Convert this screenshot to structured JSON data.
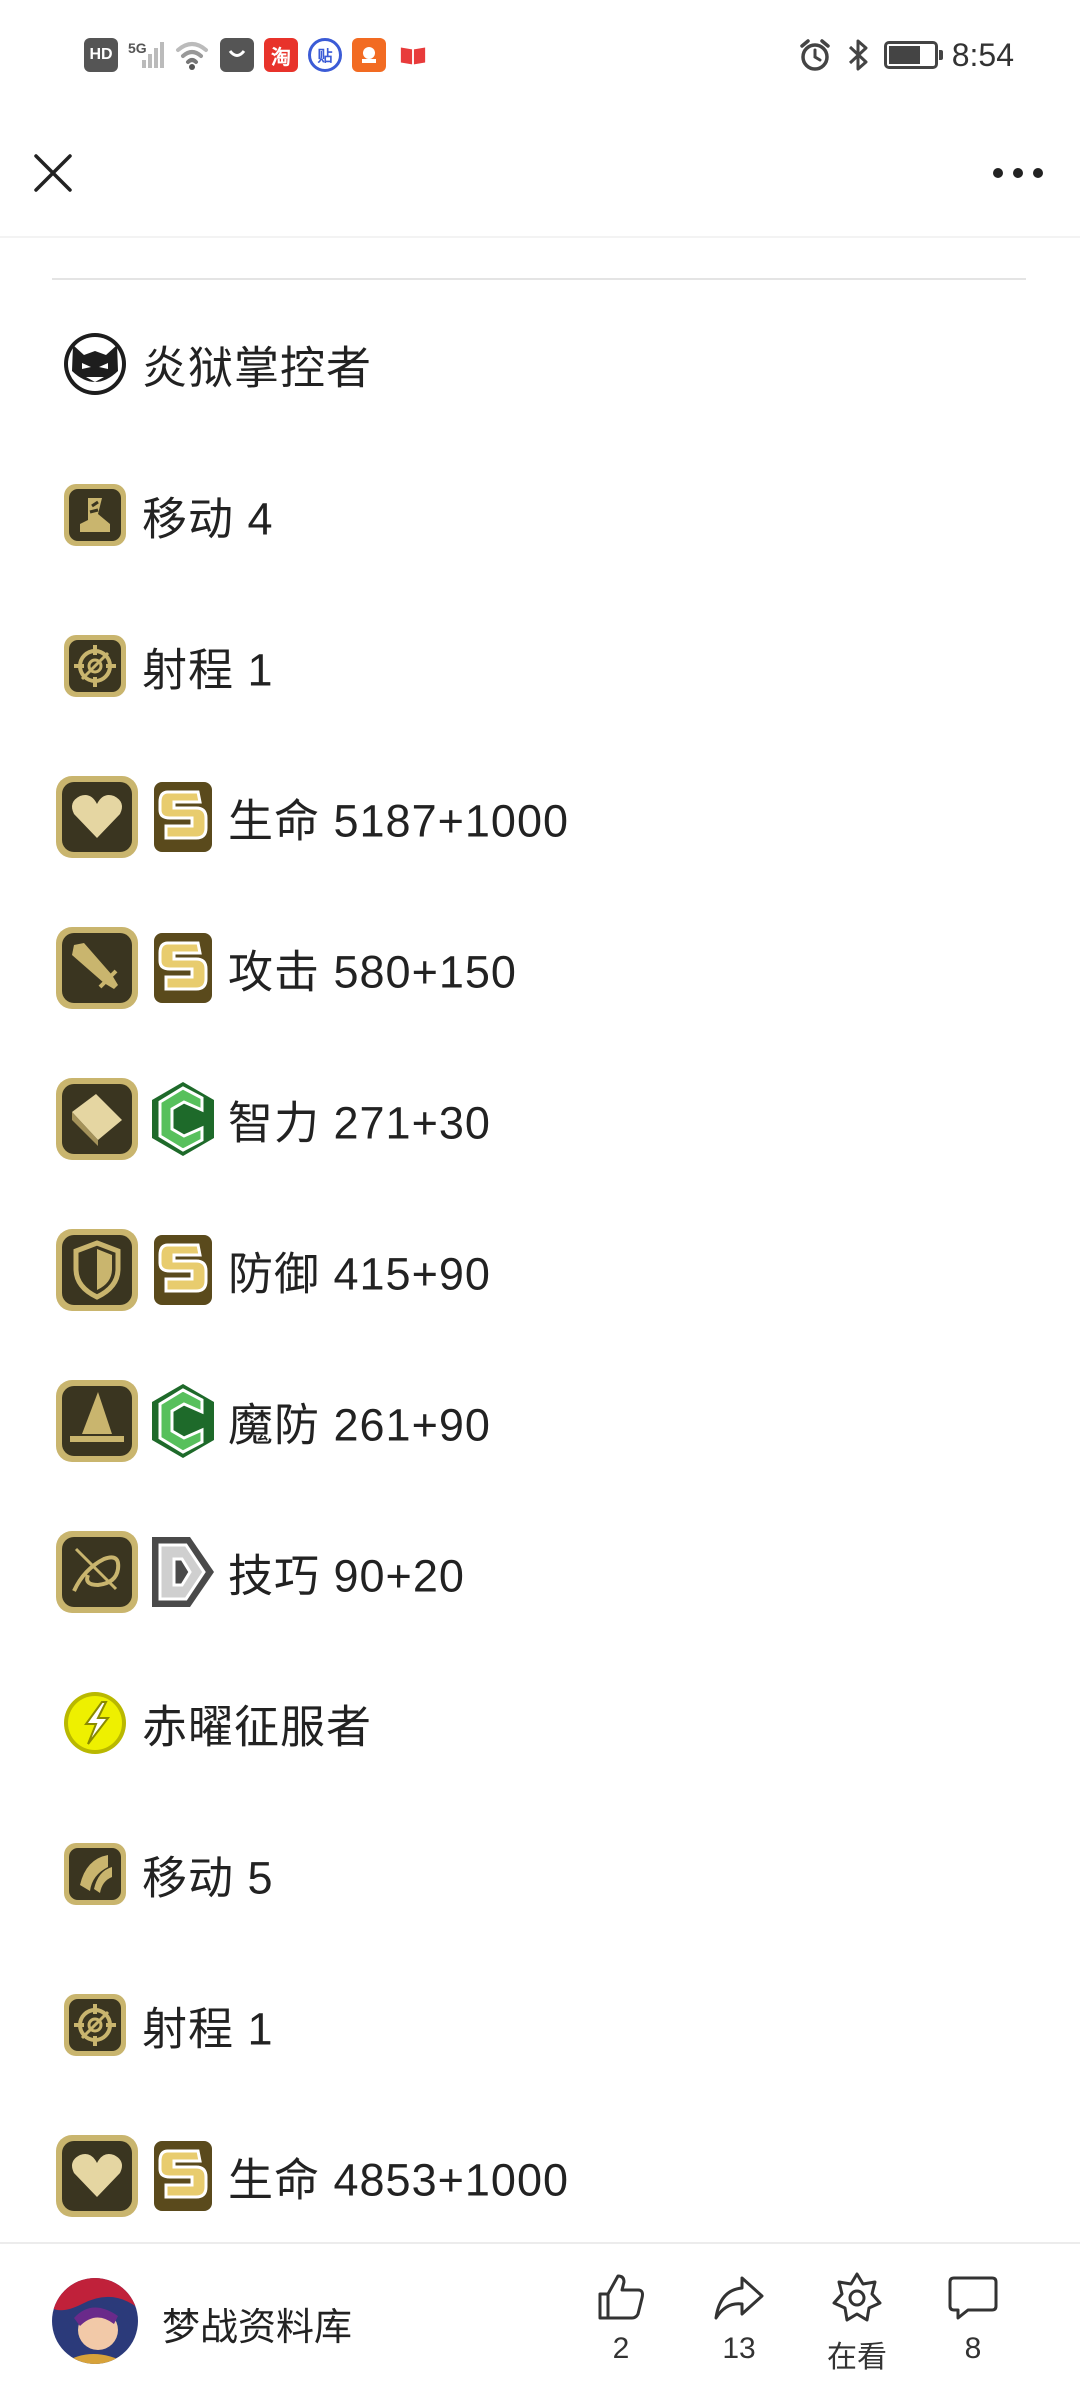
{
  "status_bar": {
    "time": "8:54",
    "hd_label": "HD",
    "network_label": "5G",
    "app_icons": [
      "bag-app-icon",
      "taobao-app-icon",
      "tieba-app-icon",
      "xianyu-app-icon",
      "book-app-icon"
    ],
    "taobao_label": "淘",
    "tieba_label": "贴"
  },
  "header": {
    "close_icon": "close-icon",
    "more_icon": "more-dots-icon"
  },
  "rows": [
    {
      "kind": "title",
      "icon": "demon-face-icon",
      "text": "炎狱掌控者"
    },
    {
      "kind": "simple",
      "icon": "boot-move-icon",
      "text": "移动 4"
    },
    {
      "kind": "simple",
      "icon": "crosshair-range-icon",
      "text": "射程 1"
    },
    {
      "kind": "graded",
      "icon": "heart-hp-icon",
      "grade": "S",
      "text": "生命 5187+1000"
    },
    {
      "kind": "graded",
      "icon": "sword-attack-icon",
      "grade": "S",
      "text": "攻击 580+150"
    },
    {
      "kind": "graded",
      "icon": "book-int-icon",
      "grade": "C",
      "text": "智力 271+30"
    },
    {
      "kind": "graded",
      "icon": "shield-def-icon",
      "grade": "S",
      "text": "防御 415+90"
    },
    {
      "kind": "graded",
      "icon": "wizard-hat-mdef-icon",
      "grade": "C",
      "text": "魔防 261+90"
    },
    {
      "kind": "graded",
      "icon": "skill-swirl-icon",
      "grade": "D",
      "text": "技巧 90+20"
    },
    {
      "kind": "title",
      "icon": "yellow-bolt-icon",
      "text": "赤曜征服者"
    },
    {
      "kind": "simple",
      "icon": "wing-move-icon",
      "text": "移动 5"
    },
    {
      "kind": "simple",
      "icon": "crosshair-range-icon",
      "text": "射程 1"
    },
    {
      "kind": "graded",
      "icon": "heart-hp-icon",
      "grade": "S",
      "text": "生命 4853+1000"
    }
  ],
  "grade_colors": {
    "S": "#d9b54a",
    "C": "#3fa24a",
    "D": "#8c8c8c"
  },
  "icon_frame_color": "#3a3520",
  "icon_gold_color": "#c9b56e",
  "bottom_bar": {
    "account_name": "梦战资料库",
    "avatar_icon": "account-avatar",
    "actions": [
      {
        "icon": "thumbs-up-icon",
        "label": "2"
      },
      {
        "icon": "share-icon",
        "label": "13"
      },
      {
        "icon": "star-badge-icon",
        "label": "在看"
      },
      {
        "icon": "comment-icon",
        "label": "8"
      }
    ]
  }
}
